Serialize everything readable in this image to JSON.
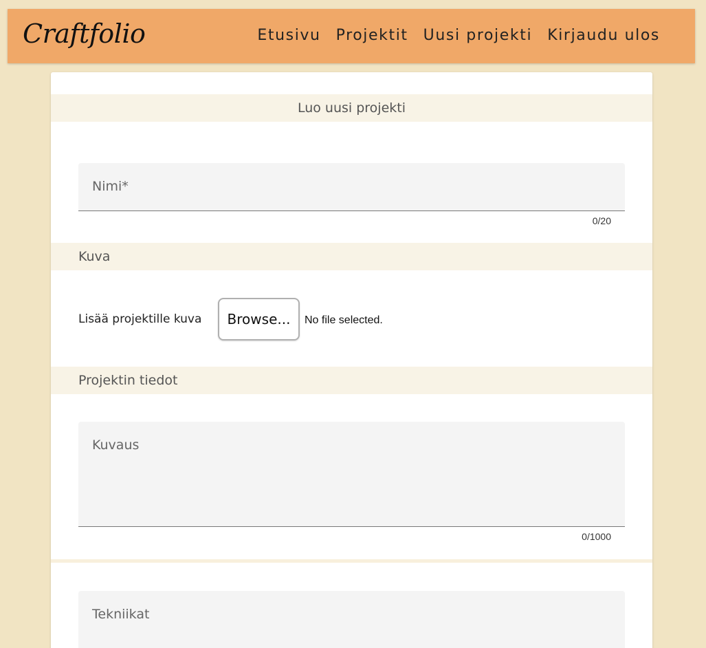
{
  "header": {
    "logo": "Craftfolio",
    "nav": [
      {
        "label": "Etusivu"
      },
      {
        "label": "Projektit"
      },
      {
        "label": "Uusi projekti"
      },
      {
        "label": "Kirjaudu ulos"
      }
    ]
  },
  "form": {
    "title": "Luo uusi projekti",
    "name_field": {
      "label": "Nimi*",
      "value": "",
      "counter": "0/20"
    },
    "image_section": {
      "heading": "Kuva",
      "upload_label": "Lisää projektille kuva",
      "browse_label": "Browse...",
      "file_status": "No file selected."
    },
    "details_section": {
      "heading": "Projektin tiedot",
      "description_field": {
        "label": "Kuvaus",
        "value": "",
        "counter": "0/1000"
      },
      "techniques_field": {
        "label": "Tekniikat",
        "value": ""
      }
    }
  },
  "colors": {
    "page_background": "#f1e4c3",
    "header_background": "#f0a868",
    "section_band": "#f8f3e6",
    "field_background": "#f4f4f4"
  }
}
